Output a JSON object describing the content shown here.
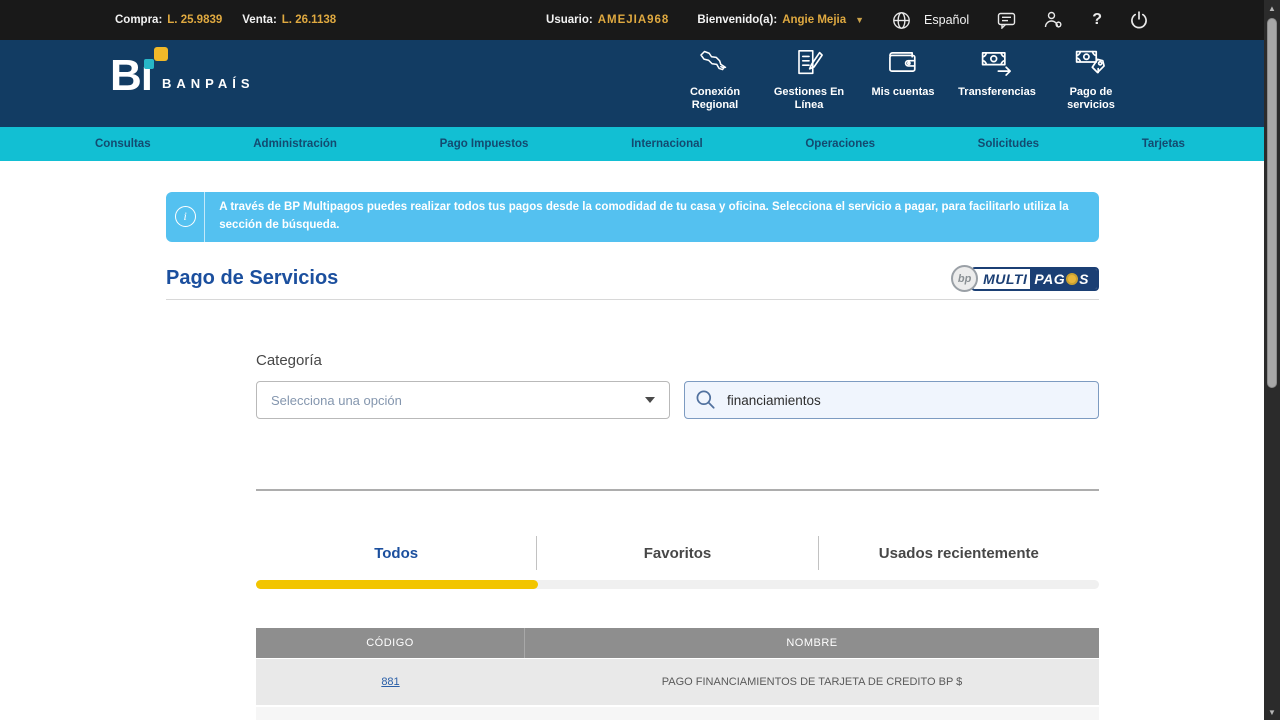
{
  "topbar": {
    "compra_label": "Compra:",
    "compra_value": "L. 25.9839",
    "venta_label": "Venta:",
    "venta_value": "L. 26.1138",
    "usuario_label": "Usuario:",
    "usuario_value": "AMEJIA968",
    "bienvenido_label": "Bienvenido(a):",
    "bienvenido_value": "Angie Mejia",
    "language": "Español"
  },
  "brand": {
    "logo_text": "B",
    "logo_i": "ı",
    "bank_name": "BANPAÍS"
  },
  "header_nav": {
    "items": [
      {
        "label": "Conexión Regional",
        "icon": "map-icon"
      },
      {
        "label": "Gestiones En Línea",
        "icon": "document-pencil-icon"
      },
      {
        "label": "Mis cuentas",
        "icon": "wallet-icon"
      },
      {
        "label": "Transferencias",
        "icon": "banknote-arrow-icon"
      },
      {
        "label": "Pago de servicios",
        "icon": "banknote-tag-icon"
      }
    ]
  },
  "menu": {
    "items": [
      "Consultas",
      "Administración",
      "Pago Impuestos",
      "Internacional",
      "Operaciones",
      "Solicitudes",
      "Tarjetas"
    ]
  },
  "banner": {
    "text": "A través de BP Multipagos puedes realizar todos tus pagos desde la comodidad de tu casa y oficina. Selecciona el servicio a pagar, para facilitarlo utiliza la sección de búsqueda."
  },
  "page": {
    "title": "Pago de Servicios"
  },
  "multipagos": {
    "bp": "bp",
    "multi": "MULTI",
    "pagos_left": "PAG",
    "pagos_right": "S"
  },
  "filters": {
    "category_label": "Categoría",
    "category_placeholder": "Selecciona una opción",
    "search_value": "financiamientos"
  },
  "tabs": {
    "items": [
      "Todos",
      "Favoritos",
      "Usados recientemente"
    ],
    "active": "Todos"
  },
  "table": {
    "headers": [
      "CÓDIGO",
      "NOMBRE"
    ],
    "rows": [
      {
        "codigo": "881",
        "nombre": "PAGO FINANCIAMIENTOS DE TARJETA DE CREDITO BP $"
      }
    ]
  },
  "colors": {
    "topbar_bg": "#191919",
    "navy": "#123c63",
    "cyan": "#12bfd3",
    "gold": "#dfa940",
    "banner_blue": "#54c1f0",
    "title_blue": "#1b4f9e",
    "tab_yellow": "#f2c500",
    "link_blue": "#2a5fa8",
    "table_header_gray": "#8e8e8e",
    "row_gray": "#e9e9e9"
  }
}
